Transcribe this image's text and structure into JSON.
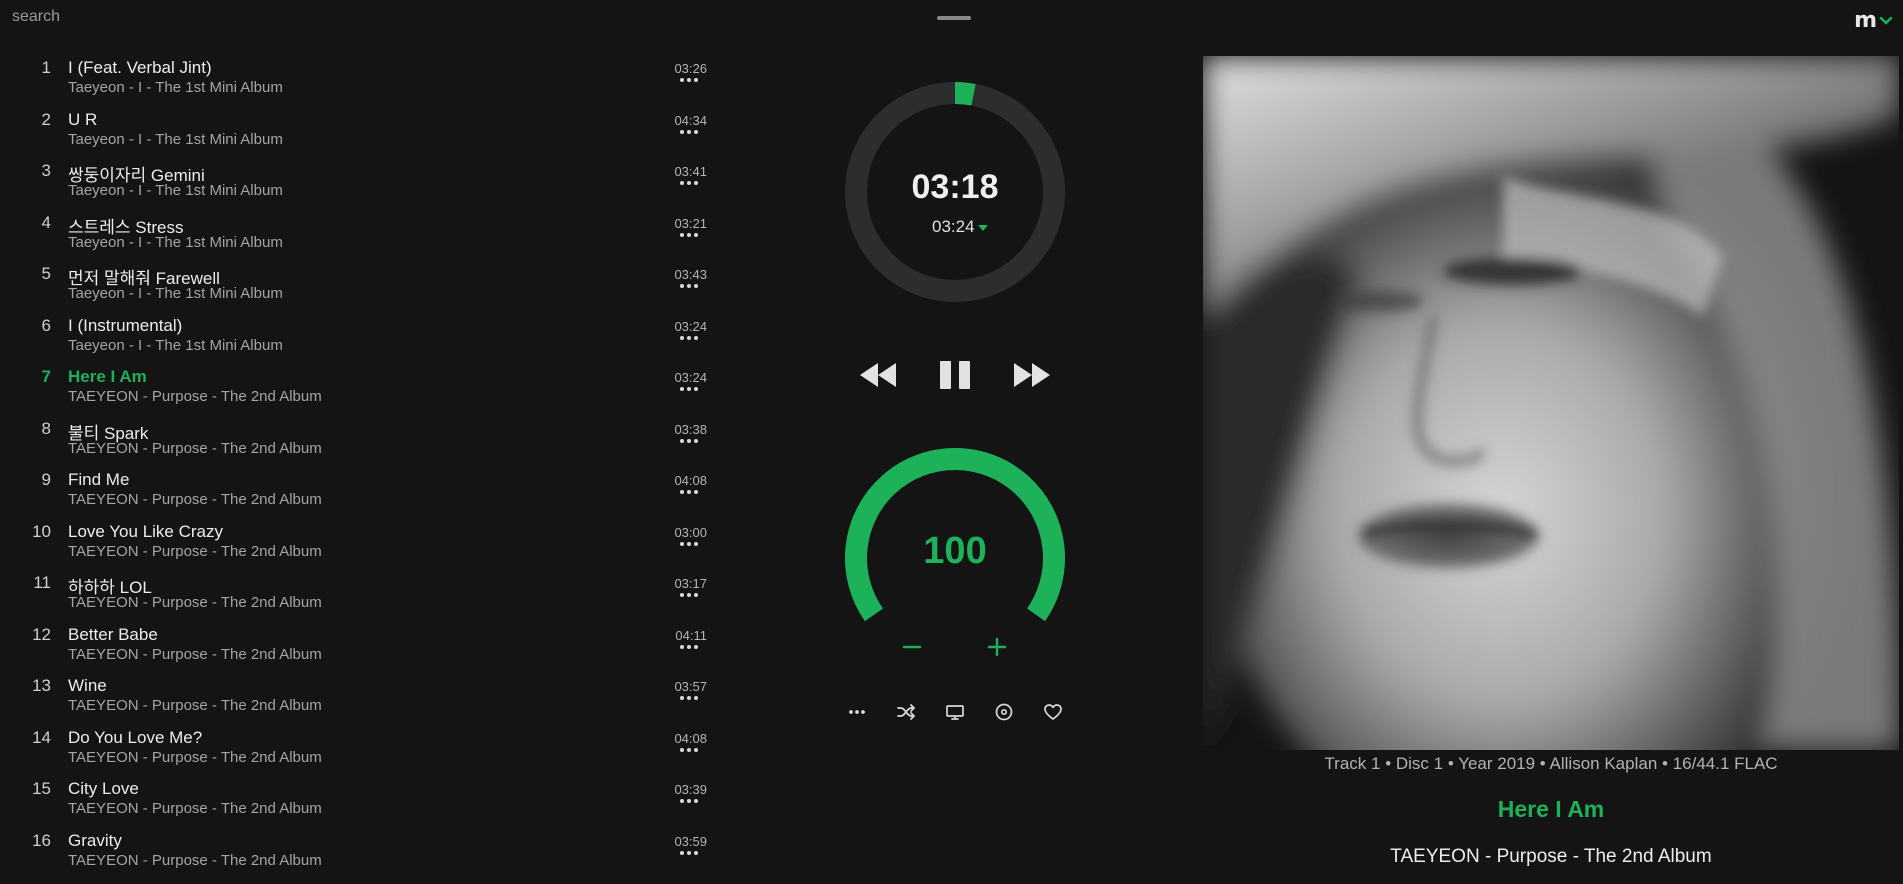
{
  "search": {
    "placeholder": "search"
  },
  "menu": {
    "label": "m"
  },
  "tracks": [
    {
      "num": "1",
      "title": "I (Feat. Verbal Jint)",
      "sub": "Taeyeon - I - The 1st Mini Album",
      "duration": "03:26"
    },
    {
      "num": "2",
      "title": "U R",
      "sub": "Taeyeon - I - The 1st Mini Album",
      "duration": "04:34"
    },
    {
      "num": "3",
      "title": "쌍둥이자리 Gemini",
      "sub": "Taeyeon - I - The 1st Mini Album",
      "duration": "03:41"
    },
    {
      "num": "4",
      "title": "스트레스 Stress",
      "sub": "Taeyeon - I - The 1st Mini Album",
      "duration": "03:21"
    },
    {
      "num": "5",
      "title": "먼저 말해줘 Farewell",
      "sub": "Taeyeon - I - The 1st Mini Album",
      "duration": "03:43"
    },
    {
      "num": "6",
      "title": "I (Instrumental)",
      "sub": "Taeyeon - I - The 1st Mini Album",
      "duration": "03:24"
    },
    {
      "num": "7",
      "title": "Here I Am",
      "sub": "TAEYEON - Purpose - The 2nd Album",
      "duration": "03:24",
      "active": true
    },
    {
      "num": "8",
      "title": "불티 Spark",
      "sub": "TAEYEON - Purpose - The 2nd Album",
      "duration": "03:38"
    },
    {
      "num": "9",
      "title": "Find Me",
      "sub": "TAEYEON - Purpose - The 2nd Album",
      "duration": "04:08"
    },
    {
      "num": "10",
      "title": "Love You Like Crazy",
      "sub": "TAEYEON - Purpose - The 2nd Album",
      "duration": "03:00"
    },
    {
      "num": "11",
      "title": "하하하 LOL",
      "sub": "TAEYEON - Purpose - The 2nd Album",
      "duration": "03:17"
    },
    {
      "num": "12",
      "title": "Better Babe",
      "sub": "TAEYEON - Purpose - The 2nd Album",
      "duration": "04:11"
    },
    {
      "num": "13",
      "title": "Wine",
      "sub": "TAEYEON - Purpose - The 2nd Album",
      "duration": "03:57"
    },
    {
      "num": "14",
      "title": "Do You Love Me?",
      "sub": "TAEYEON - Purpose - The 2nd Album",
      "duration": "04:08"
    },
    {
      "num": "15",
      "title": "City Love",
      "sub": "TAEYEON - Purpose - The 2nd Album",
      "duration": "03:39"
    },
    {
      "num": "16",
      "title": "Gravity",
      "sub": "TAEYEON - Purpose - The 2nd Album",
      "duration": "03:59"
    }
  ],
  "player": {
    "current_time": "03:18",
    "total_time": "03:24",
    "progress_fraction": 0.03,
    "volume": "100",
    "volume_fraction": 1.0
  },
  "now_playing": {
    "meta": "Track 1 • Disc 1 • Year 2019 • Allison Kaplan • 16/44.1 FLAC",
    "title": "Here I Am",
    "subtitle": "TAEYEON - Purpose - The 2nd Album"
  },
  "icons": {
    "rewind": "rewind-icon",
    "pause": "pause-icon",
    "fast_forward": "fast-forward-icon",
    "more": "more-dots-icon",
    "shuffle": "shuffle-icon",
    "monitor": "monitor-icon",
    "disc": "disc-icon",
    "heart": "heart-icon",
    "chevron": "chevron-down-icon"
  },
  "colors": {
    "accent": "#1db15a",
    "background": "#141414",
    "ring_track": "#2d2d2d"
  }
}
